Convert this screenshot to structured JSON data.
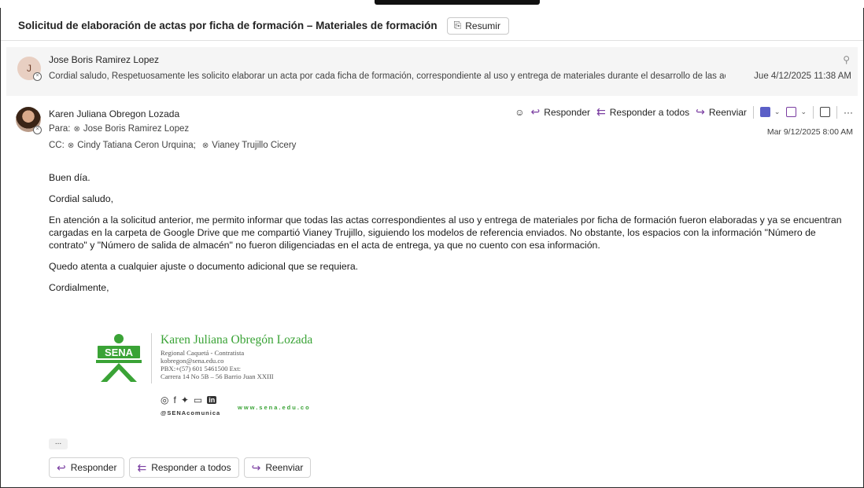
{
  "subject": "Solicitud de elaboración de actas por ficha de formación – Materiales de formación",
  "summarize_label": "Resumir",
  "previous_message": {
    "avatar_initial": "J",
    "sender": "Jose Boris Ramirez Lopez",
    "preview": "Cordial saludo, Respetuosamente les solicito elaborar un acta por cada ficha de formación, correspondiente al uso y entrega de materiales durante el desarrollo de las activid...",
    "date": "Jue 4/12/2025 11:38 AM"
  },
  "message": {
    "sender": "Karen Juliana Obregon Lozada",
    "to_label": "Para:",
    "to": [
      "Jose Boris Ramirez Lopez"
    ],
    "cc_label": "CC:",
    "cc": [
      "Cindy Tatiana Ceron Urquina;",
      "Vianey Trujillo Cicery"
    ],
    "date": "Mar 9/12/2025 8:00 AM",
    "actions": {
      "reply": "Responder",
      "reply_all": "Responder a todos",
      "forward": "Reenviar"
    },
    "body": [
      "Buen día.",
      "Cordial saludo,",
      "En atención a la solicitud anterior, me permito informar que todas las actas correspondientes al uso y entrega de materiales por ficha de formación fueron elaboradas y ya se encuentran cargadas en la carpeta de Google Drive que me compartió Vianey Trujillo, siguiendo los modelos de referencia enviados. No obstante, los espacios con la información \"Número de contrato\" y \"Número de salida de almacén\" no fueron diligenciadas en el acta de entrega, ya que no cuento con esa información.",
      "Quedo atenta a cualquier ajuste o documento adicional que se requiera.",
      "Cordialmente,"
    ],
    "signature": {
      "logo_text": "SENA",
      "name": "Karen Juliana Obregón Lozada",
      "lines": [
        "Regional Caquetá - Contratista",
        "kobregon@sena.edu.co",
        "PBX:+(57) 601 5461500 Ext:",
        "Carrera 14 No 5B – 56 Barrio Juan XXIII"
      ],
      "social_handle": "@SENAcomunica",
      "website": "www.sena.edu.co"
    },
    "more_label": "...",
    "bottom_actions": {
      "reply": "Responder",
      "reply_all": "Responder a todos",
      "forward": "Reenviar"
    }
  },
  "colors": {
    "accent": "#7a3da1",
    "sena_green": "#3aa336"
  }
}
